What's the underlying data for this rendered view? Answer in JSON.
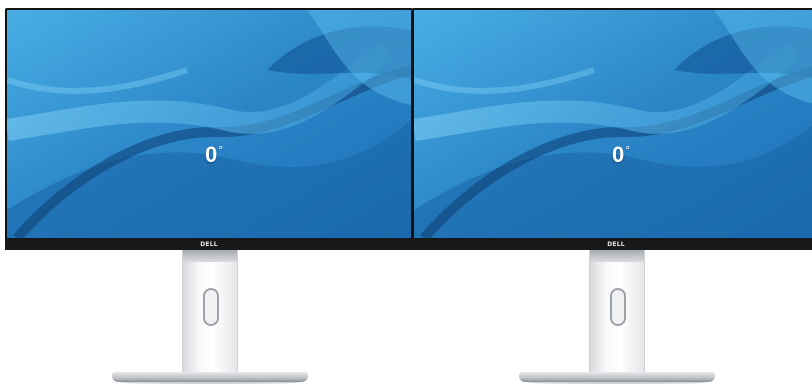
{
  "monitors": [
    {
      "angle_value": "0",
      "angle_unit": "°",
      "brand": "DELL"
    },
    {
      "angle_value": "0",
      "angle_unit": "°",
      "brand": "DELL"
    }
  ],
  "colors": {
    "bezel": "#111214",
    "screen_blue": "#2f8fd0",
    "screen_dark": "#0d4f8c",
    "stand": "#f2f3f4"
  }
}
